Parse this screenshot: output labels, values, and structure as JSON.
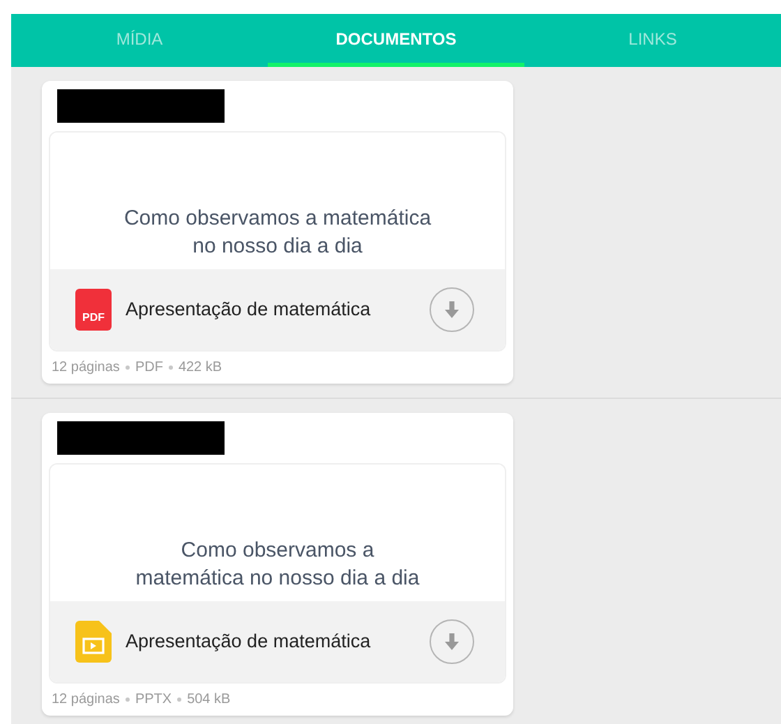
{
  "tabs": [
    {
      "label": "MÍDIA",
      "selected": false
    },
    {
      "label": "DOCUMENTOS",
      "selected": true
    },
    {
      "label": "LINKS",
      "selected": false
    }
  ],
  "documents": [
    {
      "preview_title": "Como observamos a matemática no nosso dia a dia",
      "kind": "pdf",
      "icon_text": "PDF",
      "file_name": "Apresentação de matemática",
      "meta": [
        "12 páginas",
        "PDF",
        "422 kB"
      ]
    },
    {
      "preview_title": "Como observamos a matemática no nosso dia a dia",
      "kind": "slides",
      "file_name": "Apresentação de matemática",
      "meta": [
        "12 páginas",
        "PPTX",
        "504 kB"
      ]
    }
  ]
}
